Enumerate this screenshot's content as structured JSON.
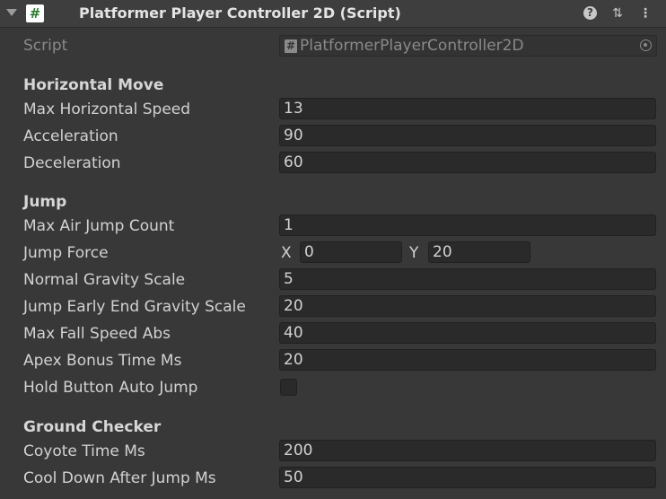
{
  "header": {
    "title": "Platformer Player Controller 2D (Script)",
    "script_icon_glyph": "#",
    "help_glyph": "?",
    "presets_glyph": "⇅",
    "menu_glyph": "⋮"
  },
  "script_field": {
    "label": "Script",
    "value": "PlatformerPlayerController2D"
  },
  "sections": {
    "horizontal_move": "Horizontal Move",
    "jump": "Jump",
    "ground_checker": "Ground Checker"
  },
  "fields": {
    "max_horizontal_speed": {
      "label": "Max Horizontal Speed",
      "value": "13"
    },
    "acceleration": {
      "label": "Acceleration",
      "value": "90"
    },
    "deceleration": {
      "label": "Deceleration",
      "value": "60"
    },
    "max_air_jump_count": {
      "label": "Max Air Jump Count",
      "value": "1"
    },
    "jump_force": {
      "label": "Jump Force",
      "x_label": "X",
      "x": "0",
      "y_label": "Y",
      "y": "20"
    },
    "normal_gravity_scale": {
      "label": "Normal Gravity Scale",
      "value": "5"
    },
    "jump_early_end_gravity_scale": {
      "label": "Jump Early End Gravity Scale",
      "value": "20"
    },
    "max_fall_speed_abs": {
      "label": "Max Fall Speed Abs",
      "value": "40"
    },
    "apex_bonus_time_ms": {
      "label": "Apex Bonus Time Ms",
      "value": "20"
    },
    "hold_button_auto_jump": {
      "label": "Hold Button Auto Jump",
      "checked": false
    },
    "coyote_time_ms": {
      "label": "Coyote Time Ms",
      "value": "200"
    },
    "cool_down_after_jump_ms": {
      "label": "Cool Down After Jump Ms",
      "value": "50"
    }
  }
}
